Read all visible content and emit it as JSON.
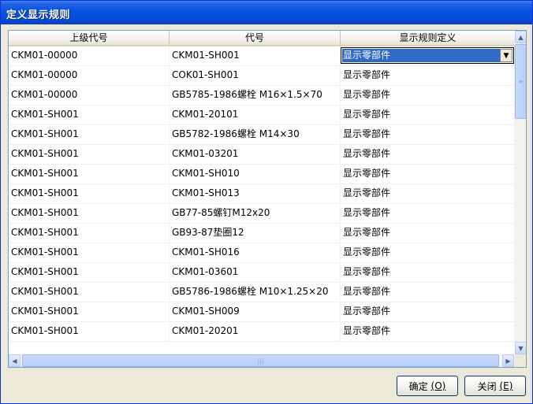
{
  "window": {
    "title": "定义显示规则"
  },
  "table": {
    "columns": [
      "上级代号",
      "代号",
      "显示规则定义"
    ],
    "rows": [
      [
        "CKM01-00000",
        "CKM01-SH001",
        "显示零部件"
      ],
      [
        "CKM01-00000",
        "COK01-SH001",
        "显示零部件"
      ],
      [
        "CKM01-00000",
        "GB5785-1986螺栓 M16×1.5×70",
        "显示零部件"
      ],
      [
        "CKM01-SH001",
        "CKM01-20101",
        "显示零部件"
      ],
      [
        "CKM01-SH001",
        "GB5782-1986螺栓 M14×30",
        "显示零部件"
      ],
      [
        "CKM01-SH001",
        "CKM01-03201",
        "显示零部件"
      ],
      [
        "CKM01-SH001",
        "CKM01-SH010",
        "显示零部件"
      ],
      [
        "CKM01-SH001",
        "CKM01-SH013",
        "显示零部件"
      ],
      [
        "CKM01-SH001",
        "GB77-85螺钉M12x20",
        "显示零部件"
      ],
      [
        "CKM01-SH001",
        "GB93-87垫圈12",
        "显示零部件"
      ],
      [
        "CKM01-SH001",
        "CKM01-SH016",
        "显示零部件"
      ],
      [
        "CKM01-SH001",
        "CKM01-03601",
        "显示零部件"
      ],
      [
        "CKM01-SH001",
        "GB5786-1986螺栓 M10×1.25×20",
        "显示零部件"
      ],
      [
        "CKM01-SH001",
        "CKM01-SH009",
        "显示零部件"
      ],
      [
        "CKM01-SH001",
        "CKM01-20201",
        "显示零部件"
      ]
    ],
    "selected_row": 0
  },
  "buttons": {
    "ok": {
      "label": "确定",
      "accel": "(O)"
    },
    "close": {
      "label": "关闭",
      "accel": "(E)"
    }
  },
  "icons": {
    "dropdown": "chevron-down-icon",
    "scroll_up": "arrow-up-icon",
    "scroll_down": "arrow-down-icon",
    "scroll_left": "arrow-left-icon",
    "scroll_right": "arrow-right-icon"
  },
  "colors": {
    "titlebar": "#0A53E0",
    "selection": "#316AC5",
    "dialog_bg": "#ECE9D8"
  }
}
